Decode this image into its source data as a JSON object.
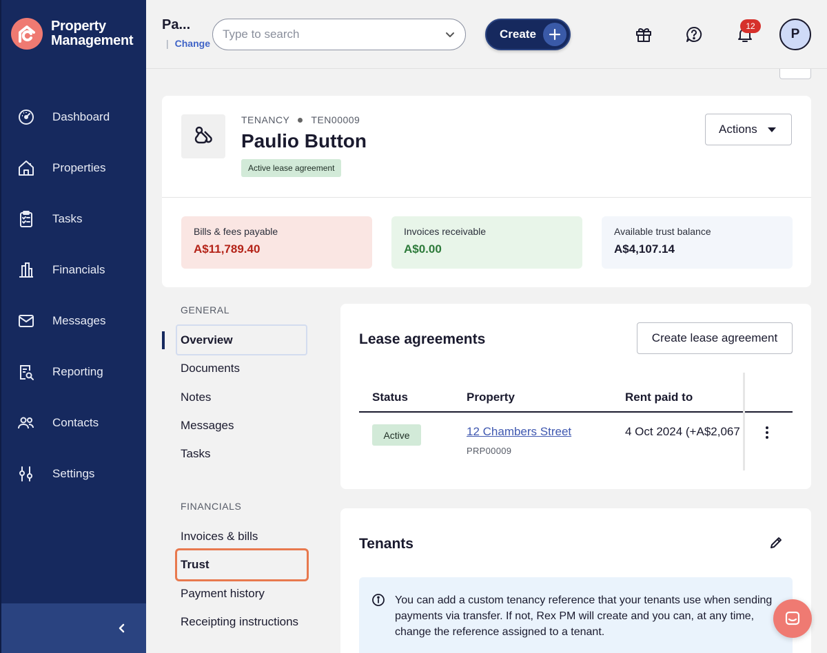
{
  "brand": {
    "line1": "Property",
    "line2": "Management"
  },
  "sidebar": {
    "items": [
      {
        "label": "Dashboard",
        "icon": "dashboard-icon"
      },
      {
        "label": "Properties",
        "icon": "home-icon"
      },
      {
        "label": "Tasks",
        "icon": "clipboard-icon"
      },
      {
        "label": "Financials",
        "icon": "bank-icon"
      },
      {
        "label": "Messages",
        "icon": "mail-icon"
      },
      {
        "label": "Reporting",
        "icon": "report-search-icon"
      },
      {
        "label": "Contacts",
        "icon": "people-icon"
      },
      {
        "label": "Settings",
        "icon": "sliders-icon"
      }
    ],
    "collapse_icon": "chevron-left-icon"
  },
  "header": {
    "agency_name": "Pa...",
    "change_label": "Change",
    "search_placeholder": "Type to search",
    "create_label": "Create",
    "notification_count": "12",
    "avatar_initial": "P"
  },
  "tenancy": {
    "type_label": "TENANCY",
    "reference": "TEN00009",
    "name": "Paulio Button",
    "status_pill": "Active lease agreement",
    "actions_label": "Actions",
    "stats": {
      "bills_label": "Bills & fees payable",
      "bills_value": "A$11,789.40",
      "invoices_label": "Invoices receivable",
      "invoices_value": "A$0.00",
      "trust_label": "Available trust balance",
      "trust_value": "A$4,107.14"
    }
  },
  "subnav": {
    "general_heading": "GENERAL",
    "general_items": [
      "Overview",
      "Documents",
      "Notes",
      "Messages",
      "Tasks"
    ],
    "financials_heading": "FINANCIALS",
    "financials_items": [
      "Invoices & bills",
      "Trust",
      "Payment history",
      "Receipting instructions"
    ],
    "active": "Overview",
    "highlighted": "Trust"
  },
  "lease": {
    "title": "Lease agreements",
    "create_label": "Create lease agreement",
    "columns": [
      "Status",
      "Property",
      "Rent paid to"
    ],
    "rows": [
      {
        "status": "Active",
        "property": "12 Chambers Street",
        "property_ref": "PRP00009",
        "rent_paid_to": "4 Oct 2024 (+A$2,067"
      }
    ]
  },
  "tenants": {
    "title": "Tenants",
    "info_text": "You can add a custom tenancy reference that your tenants use when sending payments via transfer. If not, Rex PM will create and you can, at any time, change the reference assigned to a tenant."
  },
  "colors": {
    "sidebar": "#16295e",
    "accent": "#ef7a72",
    "link": "#3f58b0",
    "danger": "#b42318",
    "success": "#2d7a3a",
    "highlight_border": "#e8794e"
  }
}
